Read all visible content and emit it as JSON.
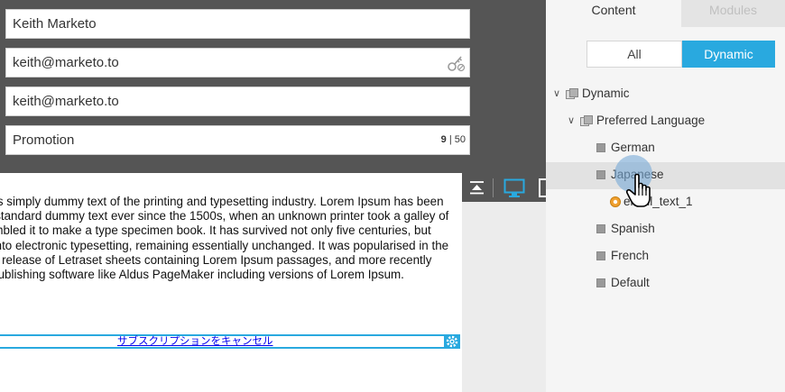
{
  "form": {
    "name_value": "Keith Marketo",
    "email_value": "keith@marketo.to",
    "reply_to_value": "keith@marketo.to",
    "subject_value": "Promotion",
    "subject_count_current": "9",
    "subject_count_sep": "|",
    "subject_count_max": "50"
  },
  "email_body": {
    "lorem_text": "Lorem Ipsum is simply dummy text of the printing and typesetting industry. Lorem Ipsum has been the industry's standard dummy text ever since the 1500s, when an unknown printer took a galley of type and scrambled it to make a type specimen book. It has survived not only five centuries, but also the leap into electronic typesetting, remaining essentially unchanged. It was popularised in the 1960s with the release of Letraset sheets containing Lorem Ipsum passages, and more recently with desktop publishing software like Aldus PageMaker including versions of Lorem Ipsum.",
    "unsubscribe_text": "サブスクリプションをキャンセル"
  },
  "toolbar": {
    "icons": [
      "collapse-top-icon",
      "desktop-icon",
      "tablet-icon"
    ]
  },
  "right_panel": {
    "tabs": [
      {
        "label": "Content",
        "active": true
      },
      {
        "label": "Modules",
        "active": false
      }
    ],
    "filter": {
      "all_label": "All",
      "dynamic_label": "Dynamic",
      "selected": "Dynamic"
    },
    "tree": {
      "root_label": "Dynamic",
      "segmentation_label": "Preferred Language",
      "segments": [
        "German",
        "Japanese",
        "Spanish",
        "French",
        "Default"
      ],
      "selected_segment": "Japanese",
      "child_of_selected": "email_text_1"
    }
  },
  "colors": {
    "accent": "#29a9df",
    "dark_background": "#555555",
    "panel_background": "#f5f5f5",
    "link": "#0000ee"
  }
}
